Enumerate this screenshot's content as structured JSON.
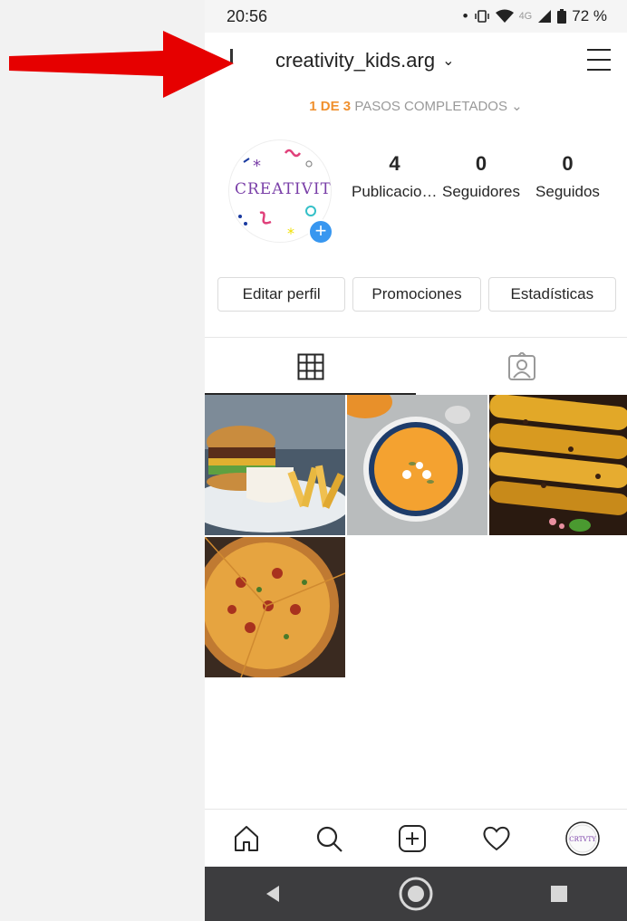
{
  "status_bar": {
    "time": "20:56",
    "network": "4G",
    "battery": "72 %"
  },
  "header": {
    "username": "creativity_kids.arg",
    "dropdown_glyph": "⌄"
  },
  "steps": {
    "highlight": "1 DE 3",
    "rest": "PASOS COMPLETADOS",
    "chevron": "⌄"
  },
  "profile": {
    "avatar_text": "CREATIVITY",
    "stats": [
      {
        "value": "4",
        "label": "Publicaciones"
      },
      {
        "value": "0",
        "label": "Seguidores"
      },
      {
        "value": "0",
        "label": "Seguidos"
      }
    ]
  },
  "buttons": {
    "edit": "Editar perfil",
    "promotions": "Promociones",
    "stats": "Estadísticas"
  },
  "tabs": [
    {
      "icon": "grid-icon"
    },
    {
      "icon": "tagged-user-icon"
    }
  ],
  "posts": [
    {
      "subject": "burger and fries"
    },
    {
      "subject": "pumpkin soup"
    },
    {
      "subject": "grilled corn"
    },
    {
      "subject": "pizza"
    }
  ],
  "bottom_nav": [
    "home-icon",
    "search-icon",
    "add-post-icon",
    "heart-icon",
    "profile-avatar"
  ],
  "system_nav": [
    "back-icon",
    "home-circle-icon",
    "recents-icon"
  ],
  "colors": {
    "accent": "#3897f0",
    "steps_highlight": "#f0902e",
    "arrow": "#e60000"
  }
}
